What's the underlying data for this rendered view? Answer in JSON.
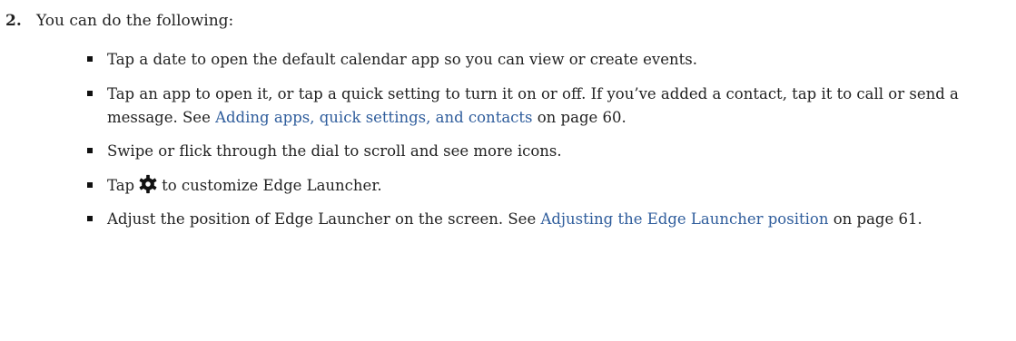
{
  "step": {
    "number": "2.",
    "text": "You can do the following:"
  },
  "bullets": [
    {
      "text": "Tap a date to open the default calendar app so you can view or create events."
    },
    {
      "text_before": "Tap an app to open it, or tap a quick setting to turn it on or off. If you’ve added a contact, tap it to call or send a message. See ",
      "link": "Adding apps, quick settings, and contacts",
      "text_after": " on page 60."
    },
    {
      "text": "Swipe or flick through the dial to scroll and see more icons."
    },
    {
      "text_before": "Tap",
      "icon": "gear-icon",
      "text_after": "to customize Edge Launcher."
    },
    {
      "text_before": "Adjust the position of Edge Launcher on the screen. See ",
      "link": "Adjusting the Edge Launcher position",
      "text_after": " on page 61."
    }
  ],
  "colors": {
    "text": "#222222",
    "link": "#2f5d9c",
    "bullet": "#111111"
  }
}
